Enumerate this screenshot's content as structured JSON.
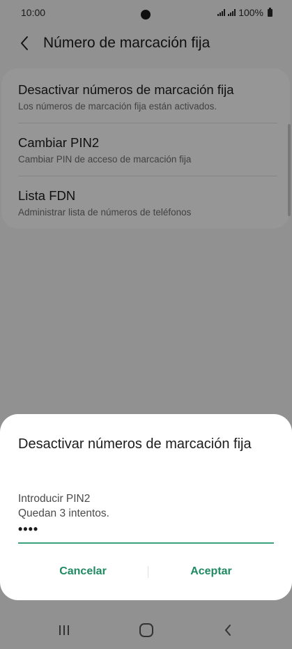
{
  "status_bar": {
    "time": "10:00",
    "battery": "100%",
    "icons": [
      "signal-icon",
      "signal-icon",
      "battery-icon"
    ]
  },
  "app_bar": {
    "title": "Número de marcación fija",
    "back_icon": "chevron-left-icon"
  },
  "settings": {
    "items": [
      {
        "title": "Desactivar números de marcación fija",
        "subtitle": "Los números de marcación fija están activados."
      },
      {
        "title": "Cambiar PIN2",
        "subtitle": "Cambiar PIN de acceso de marcación fija"
      },
      {
        "title": "Lista FDN",
        "subtitle": "Administrar lista de números de teléfonos"
      }
    ]
  },
  "dialog": {
    "title": "Desactivar números de marcación fija",
    "message_line1": "Introducir PIN2",
    "message_line2": "Quedan 3 intentos.",
    "pin_value": "••••",
    "cancel_label": "Cancelar",
    "accept_label": "Aceptar",
    "accent_color": "#1f8a62"
  },
  "nav_bar": {
    "icons": [
      "recent-apps-icon",
      "home-icon",
      "back-icon"
    ]
  }
}
